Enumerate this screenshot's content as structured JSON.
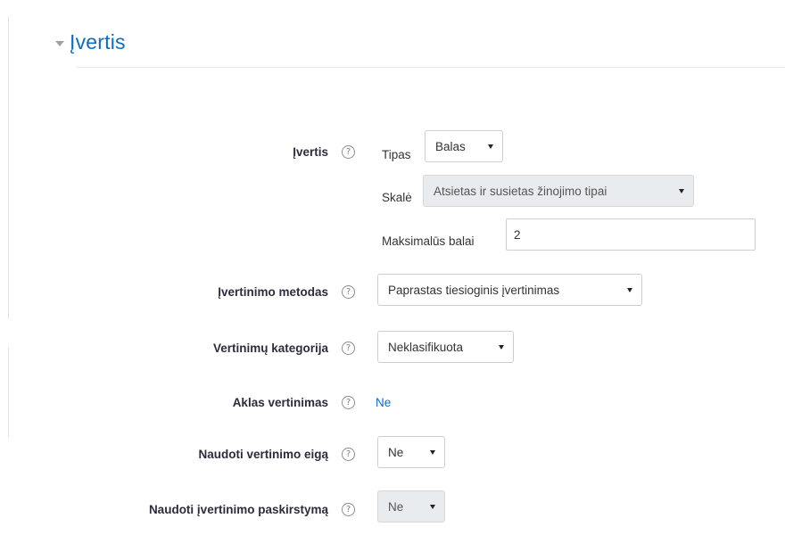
{
  "section": {
    "title": "Įvertis"
  },
  "grade": {
    "label": "Įvertis",
    "type_label": "Tipas",
    "type_value": "Balas",
    "scale_label": "Skalė",
    "scale_value": "Atsietas ir susietas žinojimo tipai",
    "maxgrade_label": "Maksimalūs balai",
    "maxgrade_value": "2"
  },
  "grading_method": {
    "label": "Įvertinimo metodas",
    "value": "Paprastas tiesioginis įvertinimas"
  },
  "grade_category": {
    "label": "Vertinimų kategorija",
    "value": "Neklasifikuota"
  },
  "blind_marking": {
    "label": "Aklas vertinimas",
    "value": "Ne"
  },
  "marking_workflow": {
    "label": "Naudoti vertinimo eigą",
    "value": "Ne"
  },
  "marking_allocation": {
    "label": "Naudoti įvertinimo paskirstymą",
    "value": "Ne"
  },
  "help_glyph": "?",
  "colors": {
    "link": "#0f6cbf",
    "label": "#2c2c3c",
    "disabled_bg": "#e9ecef"
  }
}
